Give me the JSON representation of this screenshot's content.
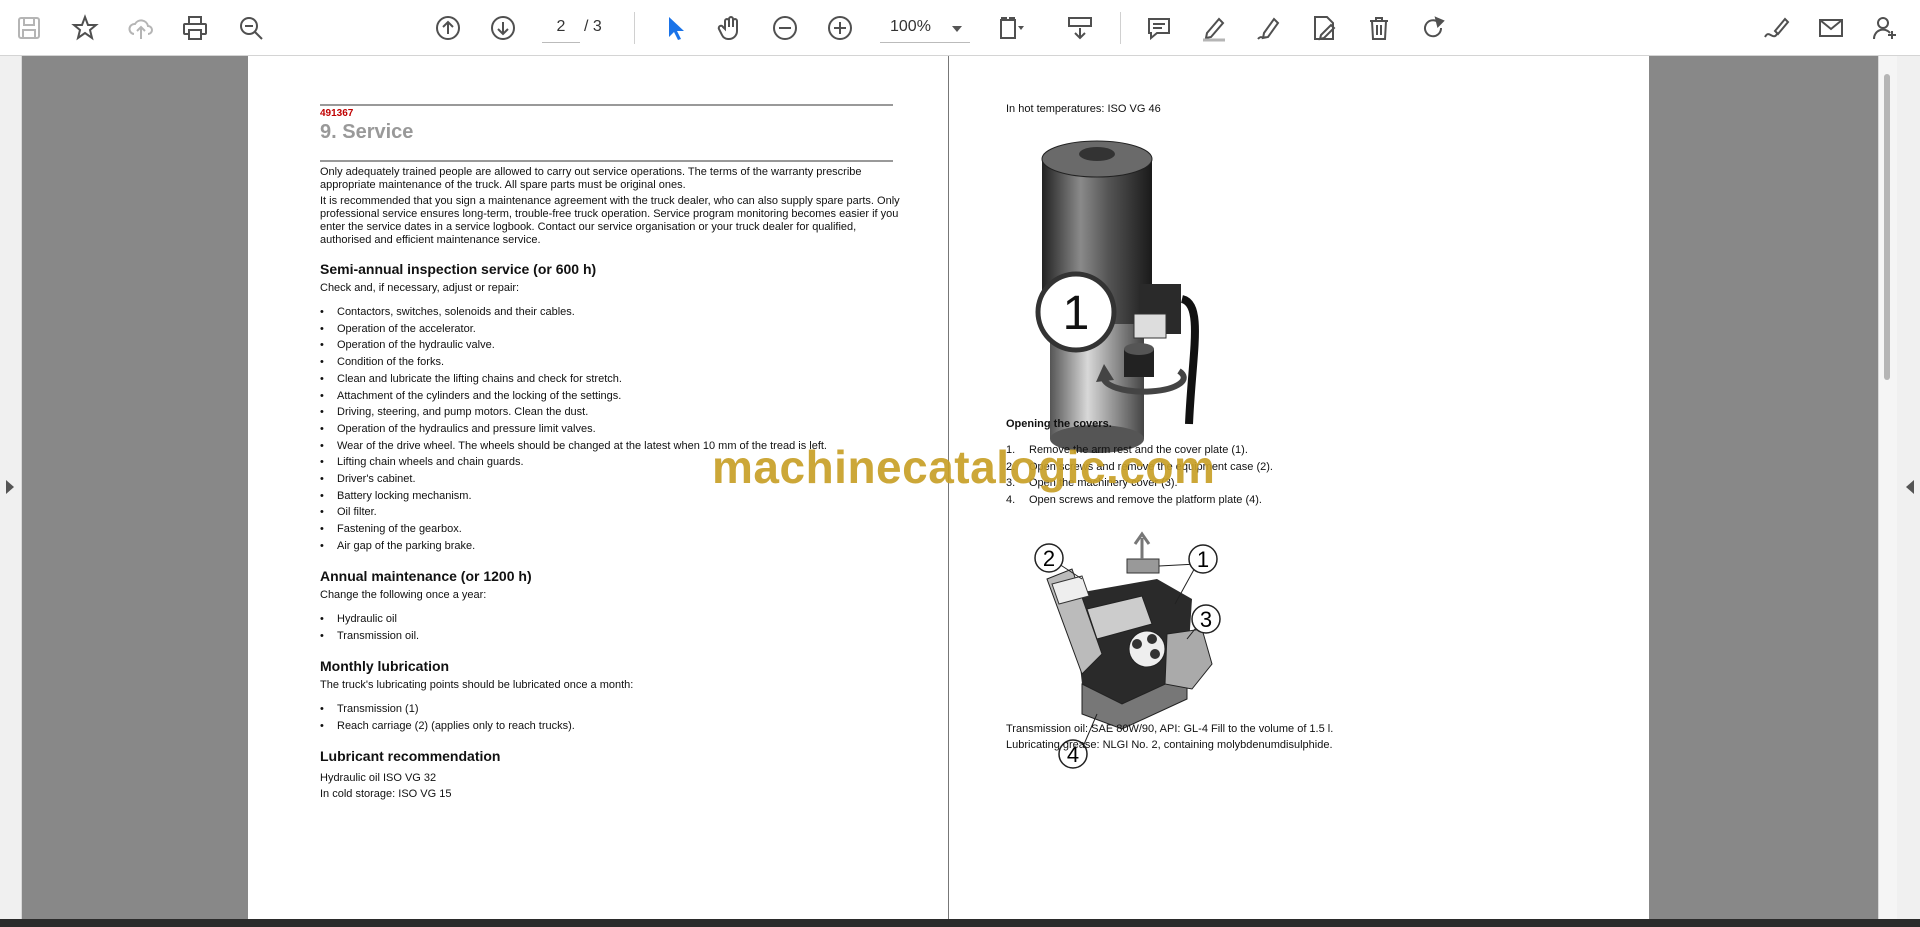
{
  "toolbar": {
    "page_current": "2",
    "page_total": "/ 3",
    "zoom": "100%",
    "colors": {
      "icon": "#505050",
      "disabled_icon": "#b5b5b5",
      "select_active": "#1a73e8"
    }
  },
  "left_page": {
    "doc_number": "491367",
    "title": "9. Service",
    "intro_1": "Only adequately trained people are allowed to carry out service operations. The terms of the warranty prescribe appropriate maintenance of the truck. All spare parts must be original ones.",
    "intro_2": "It is recommended that you sign a maintenance agreement with the truck dealer, who can also supply spare parts. Only professional service ensures long-term, trouble-free truck operation. Service program monitoring becomes easier if you enter the service dates in a service logbook. Contact our service organisation or your truck dealer for qualified, authorised and efficient maintenance service.",
    "semi_annual": {
      "heading": "Semi-annual inspection service (or 600 h)",
      "lead": "Check and, if necessary, adjust or repair:",
      "items": [
        "Contactors, switches, solenoids and their cables.",
        "Operation of the accelerator.",
        "Operation of the hydraulic valve.",
        "Condition of the forks.",
        "Clean and lubricate the lifting chains and check for stretch.",
        "Attachment of the cylinders and the locking of the settings.",
        "Driving, steering, and pump motors. Clean the dust.",
        "Operation of the hydraulics and pressure limit valves.",
        "Wear of the drive wheel. The wheels should be changed at the latest when 10 mm of the tread is left.",
        "Lifting chain wheels and chain guards.",
        "Driver's cabinet.",
        "Battery locking mechanism.",
        "Oil filter.",
        "Fastening of the gearbox.",
        "Air gap of the parking brake."
      ]
    },
    "annual": {
      "heading": "Annual maintenance (or 1200 h)",
      "lead": "Change the following once a year:",
      "items": [
        "Hydraulic oil",
        "Transmission oil."
      ]
    },
    "monthly": {
      "heading": "Monthly lubrication",
      "lead": "The truck's lubricating points should be lubricated once a month:",
      "items": [
        "Transmission (1)",
        "Reach carriage (2) (applies only to reach trucks)."
      ]
    },
    "lubricant": {
      "heading": "Lubricant recommendation",
      "line_1": "Hydraulic oil ISO VG 32",
      "line_2": "In cold storage: ISO VG 15"
    }
  },
  "right_page": {
    "hot_temp": "In hot temperatures: ISO VG 46",
    "figure1_callout": "1",
    "opening_heading": "Opening the covers.",
    "steps": [
      {
        "num": "1.",
        "text": "Remove the arm rest and the cover plate (1)."
      },
      {
        "num": "2.",
        "text": "Open screws and remove the equipment case (2)."
      },
      {
        "num": "3.",
        "text": "Open the machinery cover (3)."
      },
      {
        "num": "4.",
        "text": "Open screws and remove the platform plate (4)."
      }
    ],
    "figure2_callouts": [
      "1",
      "2",
      "3",
      "4"
    ],
    "transmission_oil": "Transmission oil: SAE 80W/90, API: GL-4 Fill to the volume of 1.5 l.",
    "grease": "Lubricating grease: NLGI No. 2, containing molybdenumdisulphide."
  },
  "watermark": "machinecatalogic.com"
}
